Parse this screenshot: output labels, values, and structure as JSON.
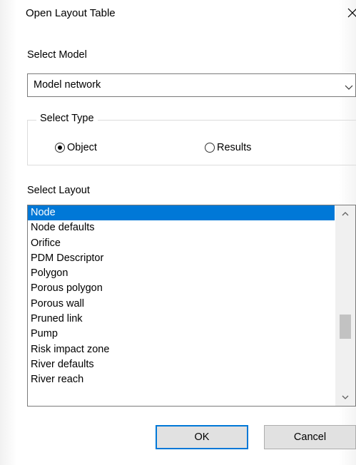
{
  "dialog": {
    "title": "Open Layout Table"
  },
  "select_model": {
    "label": "Select Model",
    "value": "Model network"
  },
  "select_type": {
    "label": "Select Type",
    "options": [
      {
        "label": "Object",
        "checked": true
      },
      {
        "label": "Results",
        "checked": false
      }
    ]
  },
  "select_layout": {
    "label": "Select Layout",
    "items": [
      "Node",
      "Node defaults",
      "Orifice",
      "PDM Descriptor",
      "Polygon",
      "Porous polygon",
      "Porous wall",
      "Pruned link",
      "Pump",
      "Risk impact zone",
      "River defaults",
      "River reach"
    ],
    "selected": "Node",
    "scroll_position": 0.6
  },
  "buttons": {
    "ok": "OK",
    "cancel": "Cancel"
  },
  "colors": {
    "selection": "#0078d7",
    "button_face": "#e1e1e1",
    "scroll_track": "#f0f0f0",
    "scroll_thumb": "#c2c2c2"
  }
}
